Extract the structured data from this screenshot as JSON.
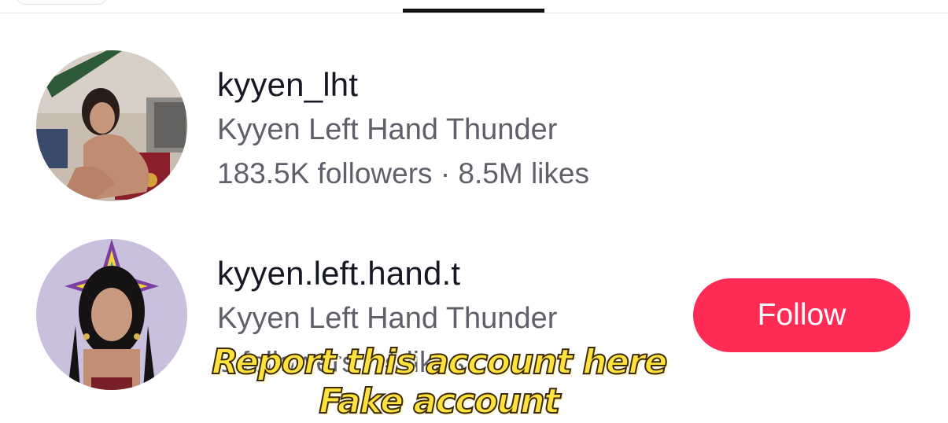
{
  "tabs": {
    "active_indicator_color": "#111111"
  },
  "results": [
    {
      "username": "kyyen_lht",
      "display_name": "Kyyen Left Hand Thunder",
      "stats": "183.5K followers · 8.5M likes",
      "avatar": "profile-photo-woman-in-room"
    },
    {
      "username": "kyyen.left.hand.t",
      "display_name": "Kyyen Left Hand Thunder",
      "stats": "0 followers · 4 likes",
      "avatar": "profile-photo-woman-star-quilt",
      "follow_label": "Follow"
    }
  ],
  "caption": {
    "line1": "Report this account here",
    "line2": "Fake account"
  },
  "colors": {
    "follow_button": "#fe2c55",
    "caption_fill": "#ffe33c",
    "primary_text": "#161823",
    "secondary_text": "#60606a"
  }
}
